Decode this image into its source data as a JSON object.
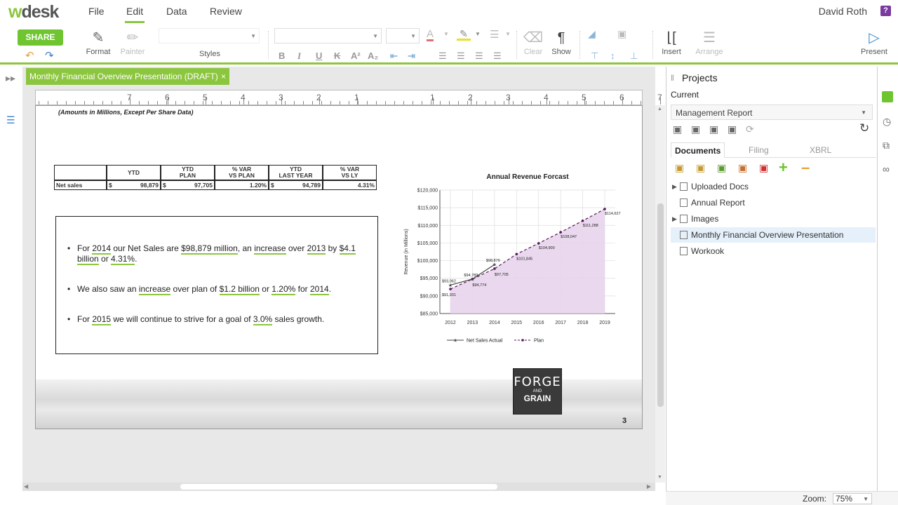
{
  "app": {
    "logo_w": "w",
    "logo_desk": "desk",
    "user": "David Roth",
    "help": "?"
  },
  "menu": [
    "File",
    "Edit",
    "Data",
    "Review"
  ],
  "toolbar": {
    "share": "SHARE",
    "format": "Format",
    "painter": "Painter",
    "styles": "Styles",
    "clear": "Clear",
    "show": "Show",
    "insert": "Insert",
    "arrange": "Arrange",
    "present": "Present",
    "fmt_bold": "B",
    "fmt_italic": "I",
    "fmt_underline": "U",
    "fmt_strike": "K",
    "fmt_sup": "A²",
    "fmt_sub": "A₂"
  },
  "doc_tab": {
    "title": "Monthly Financial Overview Presentation (DRAFT)",
    "close": "×"
  },
  "ruler": [
    "7",
    "6",
    "5",
    "4",
    "3",
    "2",
    "1",
    "1",
    "2",
    "3",
    "4",
    "5",
    "6",
    "7"
  ],
  "slide": {
    "subtitle": "(Amounts in Millions, Except Per Share Data)",
    "table": {
      "headers": [
        [
          "",
          ""
        ],
        [
          "YTD",
          ""
        ],
        [
          "YTD",
          "PLAN"
        ],
        [
          "% VAR",
          "VS PLAN"
        ],
        [
          "YTD",
          "LAST YEAR"
        ],
        [
          "% VAR",
          "VS LY"
        ]
      ],
      "row": {
        "label": "Net sales",
        "c1_sym": "$",
        "c1": "98,879",
        "c2_sym": "$",
        "c2": "97,705",
        "c3": "1.20%",
        "c4_sym": "$",
        "c4": "94,789",
        "c5": "4.31%"
      }
    },
    "bullets": {
      "b1_a": "For ",
      "b1_y1": "2014",
      "b1_b": " our Net Sales are ",
      "b1_amt": "$98,879 million",
      "b1_c": ", an ",
      "b1_inc": "increase",
      "b1_d": " over ",
      "b1_y2": "2013",
      "b1_e": " by ",
      "b1_amt2": "$4.1 billion",
      "b1_f": " or ",
      "b1_pct": "4.31%",
      "b1_g": ".",
      "b2_a": "We also saw an ",
      "b2_inc": "increase",
      "b2_b": " over plan of ",
      "b2_amt": "$1.2 billion",
      "b2_c": " or ",
      "b2_pct": "1.20%",
      "b2_d": " for ",
      "b2_y": "2014",
      "b2_e": ".",
      "b3_a": "For ",
      "b3_y": "2015",
      "b3_b": " we will continue to strive for a goal of ",
      "b3_pct": "3.0%",
      "b3_c": " sales growth."
    },
    "logo": {
      "l1": "FORGE",
      "l2": "AND",
      "l3": "GRAIN"
    },
    "page": "3"
  },
  "chart_data": {
    "type": "line",
    "title": "Annual Revenue Forcast",
    "ylabel": "Revenue (in Millions)",
    "xlabel": "",
    "x": [
      2012,
      2013,
      2014,
      2015,
      2016,
      2017,
      2018,
      2019
    ],
    "ylim": [
      85000,
      120000
    ],
    "yticks": [
      "$85,000",
      "$90,000",
      "$95,000",
      "$100,000",
      "$105,000",
      "$110,000",
      "$115,000",
      "$120,000"
    ],
    "series": [
      {
        "name": "Net Sales Actual",
        "x": [
          2012,
          2013,
          2014
        ],
        "values": [
          93062,
          94789,
          98879
        ],
        "labels": [
          "$93,062",
          "$94,789",
          "$98,879"
        ]
      },
      {
        "name": "Plan",
        "x": [
          2012,
          2013,
          2014,
          2015,
          2016,
          2017,
          2018,
          2019
        ],
        "values": [
          91931,
          94774,
          97705,
          101845,
          104900,
          108047,
          111288,
          114627
        ],
        "labels": [
          "$91,931",
          "$94,774",
          "$97,705",
          "$101,845",
          "$104,900",
          "$108,047",
          "$111,288",
          "$114,627"
        ]
      }
    ],
    "grid": true,
    "legend": "bottom",
    "colors": {
      "actual": "#444444",
      "plan": "#5a1a5a",
      "fill": "#e8d4ec"
    }
  },
  "panel": {
    "title": "Projects",
    "current_label": "Current",
    "current_value": "Management Report",
    "tabs": [
      "Documents",
      "Filing",
      "XBRL"
    ],
    "tree": [
      {
        "label": "Uploaded Docs",
        "arrow": "▶"
      },
      {
        "label": "Annual Report",
        "arrow": ""
      },
      {
        "label": "Images",
        "arrow": "▶"
      },
      {
        "label": "Monthly Financial Overview Presentation",
        "arrow": ""
      },
      {
        "label": "Workook",
        "arrow": ""
      }
    ]
  },
  "status": {
    "zoom_label": "Zoom:",
    "zoom_value": "75%"
  }
}
